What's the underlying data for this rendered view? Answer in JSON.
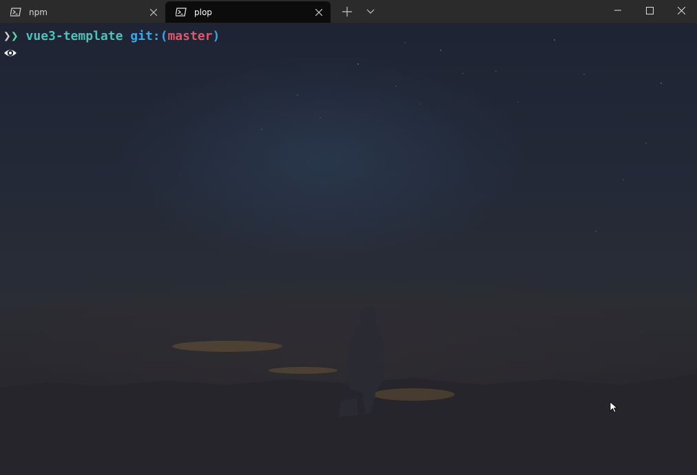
{
  "tabs": [
    {
      "label": "npm",
      "icon": "powershell-icon",
      "active": false
    },
    {
      "label": "plop",
      "icon": "powershell-icon",
      "active": true
    }
  ],
  "tab_bar": {
    "new_tab_icon": "plus-icon",
    "dropdown_icon": "chevron-down-icon"
  },
  "window_controls": [
    "minimize-icon",
    "maximize-icon",
    "close-icon"
  ],
  "terminal": {
    "prompt": {
      "chevrons": [
        "❯",
        "❯"
      ],
      "directory": "vue3-template",
      "git_prefix": "git:(",
      "branch": "master",
      "git_suffix": ")"
    },
    "second_line_icon": "eye-icon"
  },
  "colors": {
    "titlebar": "#2b2b2b",
    "active_tab": "#0c0c0c",
    "prompt_directory": "#4fc1b6",
    "prompt_git": "#3aa8e6",
    "prompt_branch": "#e0566a"
  }
}
